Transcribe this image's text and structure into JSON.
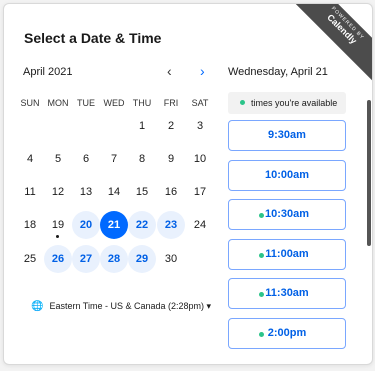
{
  "header": {
    "title": "Select a Date & Time"
  },
  "ribbon": {
    "powered": "POWERED BY",
    "brand": "Calendly"
  },
  "calendar": {
    "month": "April 2021",
    "weekdays": [
      "SUN",
      "MON",
      "TUE",
      "WED",
      "THU",
      "FRI",
      "SAT"
    ],
    "weeks": [
      [
        "",
        "",
        "",
        "",
        "1",
        "2",
        "3"
      ],
      [
        "4",
        "5",
        "6",
        "7",
        "8",
        "9",
        "10"
      ],
      [
        "11",
        "12",
        "13",
        "14",
        "15",
        "16",
        "17"
      ],
      [
        "18",
        "19",
        "20",
        "21",
        "22",
        "23",
        "24"
      ],
      [
        "25",
        "26",
        "27",
        "28",
        "29",
        "30",
        ""
      ]
    ],
    "available": [
      "20",
      "21",
      "22",
      "23",
      "26",
      "27",
      "28",
      "29"
    ],
    "selected": "21",
    "today": "19"
  },
  "timezone": {
    "label": "Eastern Time - US & Canada (2:28pm) ▾"
  },
  "panel": {
    "date": "Wednesday, April 21",
    "legend": "times you're available",
    "slots": [
      {
        "time": "9:30am",
        "dot": false
      },
      {
        "time": "10:00am",
        "dot": false
      },
      {
        "time": "10:30am",
        "dot": true
      },
      {
        "time": "11:00am",
        "dot": true
      },
      {
        "time": "11:30am",
        "dot": true
      },
      {
        "time": "2:00pm",
        "dot": true
      }
    ]
  },
  "colors": {
    "accent": "#0069ff",
    "available_bg": "#e9f1fd",
    "available_dot": "#2bc48a"
  }
}
